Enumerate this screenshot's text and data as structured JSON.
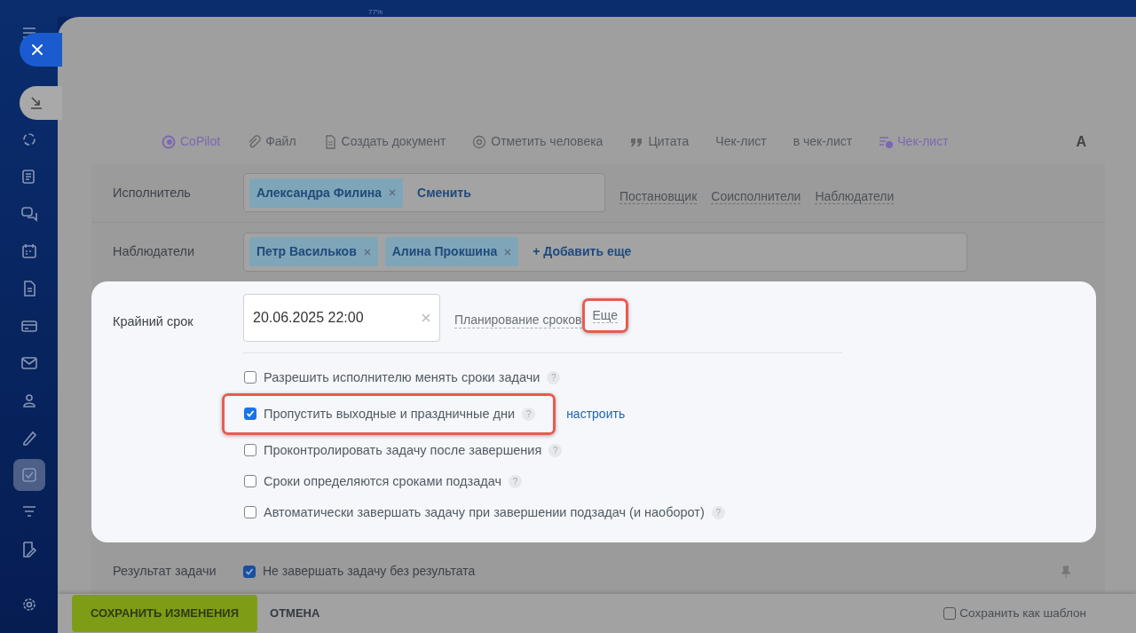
{
  "top_bar": {
    "zoom": "77%"
  },
  "sidebar": {
    "items": [
      {
        "selected": false
      },
      {
        "selected": false
      },
      {
        "selected": false
      },
      {
        "selected": false
      },
      {
        "selected": false
      },
      {
        "selected": false
      },
      {
        "selected": false
      },
      {
        "selected": false
      },
      {
        "selected": false
      },
      {
        "selected": false
      },
      {
        "selected": true
      },
      {
        "selected": false
      },
      {
        "selected": false
      }
    ]
  },
  "toolbar": {
    "items": [
      {
        "label": "CoPilot",
        "accent": true
      },
      {
        "label": "Файл",
        "accent": false
      },
      {
        "label": "Создать документ",
        "accent": false
      },
      {
        "label": "Отметить человека",
        "accent": false
      },
      {
        "label": "Цитата",
        "accent": false
      },
      {
        "label": "Чек-лист",
        "accent": false
      },
      {
        "label": "в чек-лист",
        "accent": false
      },
      {
        "label": "Чек-лист",
        "accent": true
      }
    ],
    "format": "A"
  },
  "assignee": {
    "label": "Исполнитель",
    "tags": [
      "Александра Филина"
    ],
    "action": "Сменить",
    "links": [
      "Постановщик",
      "Соисполнители",
      "Наблюдатели"
    ]
  },
  "observers": {
    "label": "Наблюдатели",
    "tags": [
      "Петр Васильков",
      "Алина Прокшина"
    ],
    "action": "+ Добавить еще"
  },
  "deadline": {
    "label": "Крайний срок",
    "value": "20.06.2025 22:00",
    "links": [
      {
        "label": "Планирование сроков",
        "annotated": false
      },
      {
        "label": "Еще",
        "annotated": true
      }
    ],
    "options": [
      {
        "label": "Разрешить исполнителю менять сроки задачи",
        "checked": false,
        "help": "?",
        "annotated": false
      },
      {
        "label": "Пропустить выходные и праздничные дни",
        "checked": true,
        "help": "?",
        "annotated": true,
        "link": "настроить"
      },
      {
        "label": "Проконтролировать задачу после завершения",
        "checked": false,
        "help": "?",
        "annotated": false
      },
      {
        "label": "Сроки определяются сроками подзадач",
        "checked": false,
        "help": "?",
        "annotated": false
      },
      {
        "label": "Автоматически завершать задачу при завершении подзадач (и наоборот)",
        "checked": false,
        "help": "?",
        "annotated": false
      }
    ]
  },
  "result": {
    "label": "Результат задачи",
    "option": {
      "label": "Не завершать задачу без результата",
      "checked": true
    }
  },
  "footer": {
    "save": "СОХРАНИТЬ ИЗМЕНЕНИЯ",
    "cancel": "ОТМЕНА",
    "template": {
      "label": "Сохранить как шаблон",
      "checked": false
    }
  }
}
